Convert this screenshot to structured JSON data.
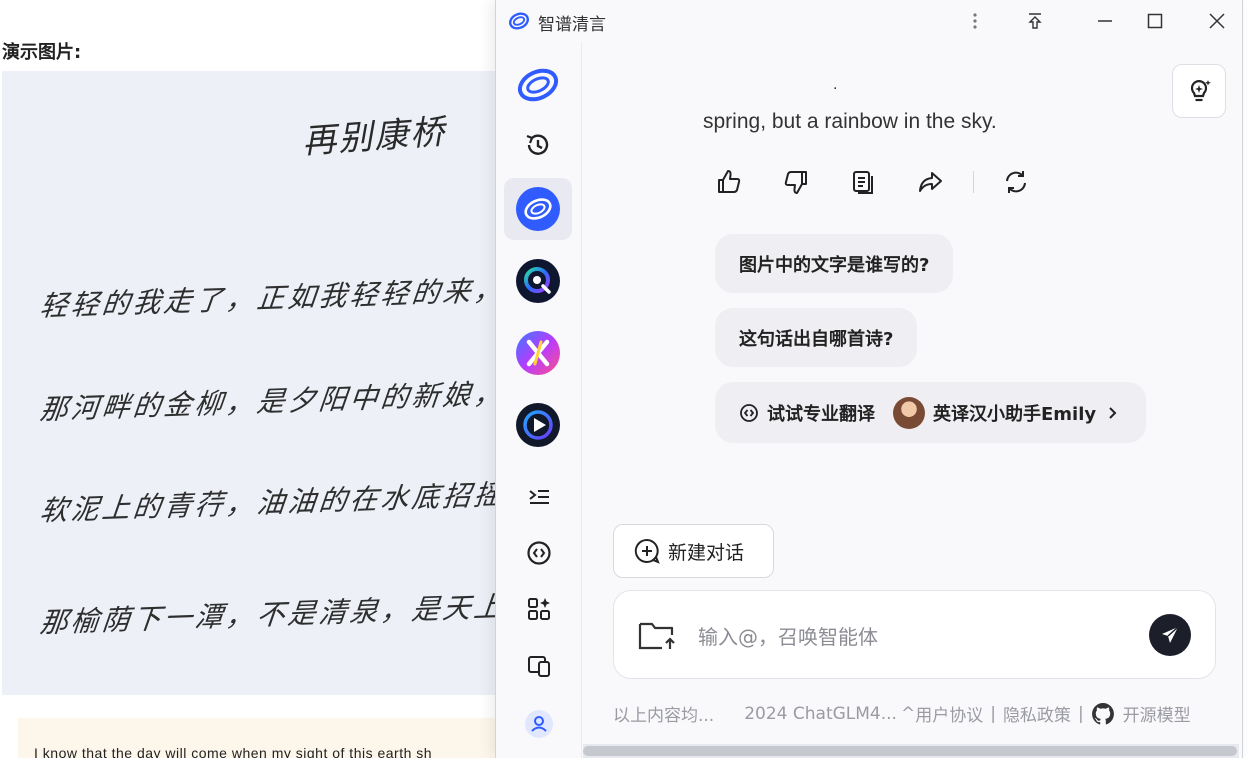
{
  "background": {
    "title": "演示图片:",
    "handwriting_title": "再别康桥",
    "handwriting_lines": [
      "轻轻的我走了，正如我轻轻的来，我轻轻",
      "那河畔的金柳，是夕阳中的新娘，波光",
      "软泥上的青荇，油油的在水底招摇，在康河",
      "那榆荫下一潭，不是清泉，是天上虹，揉碎"
    ],
    "quote": "I know that the day will come when my sight of this earth sh"
  },
  "window": {
    "title": "智谱清言"
  },
  "sidebar": {
    "items": [
      {
        "name": "logo",
        "icon": "zhipu-logo"
      },
      {
        "name": "history",
        "icon": "history-icon"
      },
      {
        "name": "chatglm",
        "icon": "chatglm-agent"
      },
      {
        "name": "agent-2",
        "icon": "search-agent"
      },
      {
        "name": "agent-3",
        "icon": "x-agent"
      },
      {
        "name": "agent-4",
        "icon": "video-agent"
      }
    ],
    "bottom": [
      "collapse-icon",
      "translate-icon",
      "apps-icon",
      "devices-icon",
      "user-icon"
    ]
  },
  "chat": {
    "dot": ".",
    "answer_tail": "spring, but a rainbow in the sky.",
    "suggestions": [
      "图片中的文字是谁写的?",
      "这句话出自哪首诗?"
    ],
    "translate_prompt": "试试专业翻译",
    "translate_agent": "英译汉小助手Emily",
    "new_chat_label": "新建对话",
    "input_placeholder": "输入@，召唤智能体"
  },
  "footer": {
    "disclaimer": "以上内容均...",
    "copyright": "2024 ChatGLM4...",
    "caret": "^",
    "user_agreement": "用户协议",
    "divider": "|",
    "privacy": "隐私政策",
    "open_models": "开源模型"
  },
  "colors": {
    "brand_blue": "#2f5bff",
    "send_button": "#1c1e2a",
    "suggestion_bg": "#efeff3"
  }
}
